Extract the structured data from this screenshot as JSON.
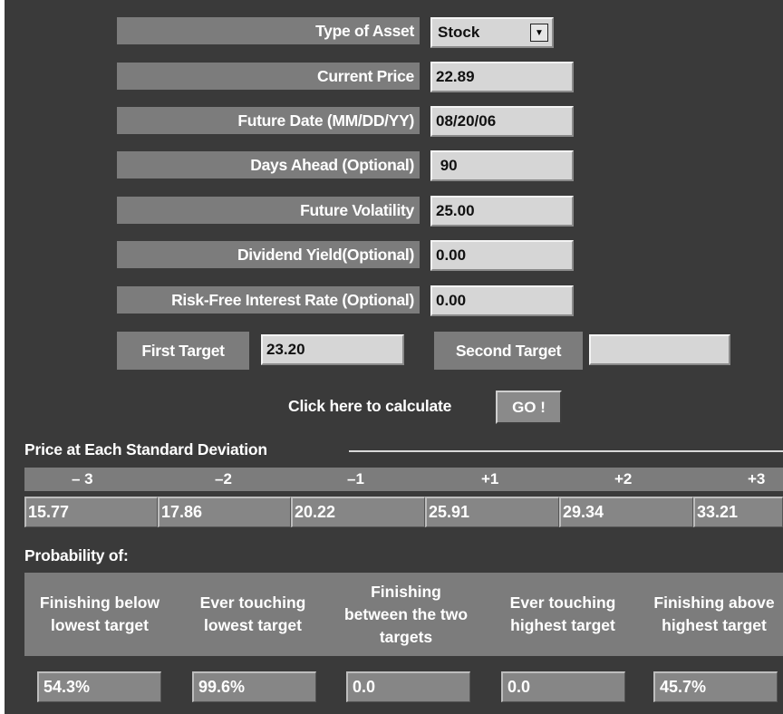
{
  "form": {
    "asset_type": {
      "label": "Type of Asset",
      "value": "Stock"
    },
    "current_price": {
      "label": "Current Price",
      "value": "22.89"
    },
    "future_date": {
      "label": "Future Date (MM/DD/YY)",
      "value": "08/20/06"
    },
    "days_ahead": {
      "label": "Days Ahead (Optional)",
      "value": " 90"
    },
    "future_volatility": {
      "label": "Future Volatility",
      "value": "25.00"
    },
    "dividend_yield": {
      "label": "Dividend Yield(Optional)",
      "value": "0.00"
    },
    "risk_free_rate": {
      "label": "Risk-Free Interest Rate (Optional)",
      "value": "0.00"
    },
    "first_target": {
      "label": "First Target",
      "value": "23.20"
    },
    "second_target": {
      "label": "Second Target",
      "value": ""
    }
  },
  "calculate": {
    "prompt": "Click here to calculate",
    "button": "GO !"
  },
  "std_dev": {
    "title": "Price at Each Standard Deviation",
    "headers": [
      "– 3",
      "–2",
      "–1",
      "+1",
      "+2",
      "+3"
    ],
    "values": [
      "15.77",
      "17.86",
      "20.22",
      "25.91",
      "29.34",
      "33.21"
    ]
  },
  "probability": {
    "title": "Probability of:",
    "headers": [
      "Finishing below lowest target",
      "Ever touching lowest target",
      "Finishing between the two targets",
      "Ever touching highest target",
      "Finishing above highest target"
    ],
    "values": [
      "54.3%",
      "99.6%",
      "0.0",
      "0.0",
      "45.7%"
    ]
  }
}
